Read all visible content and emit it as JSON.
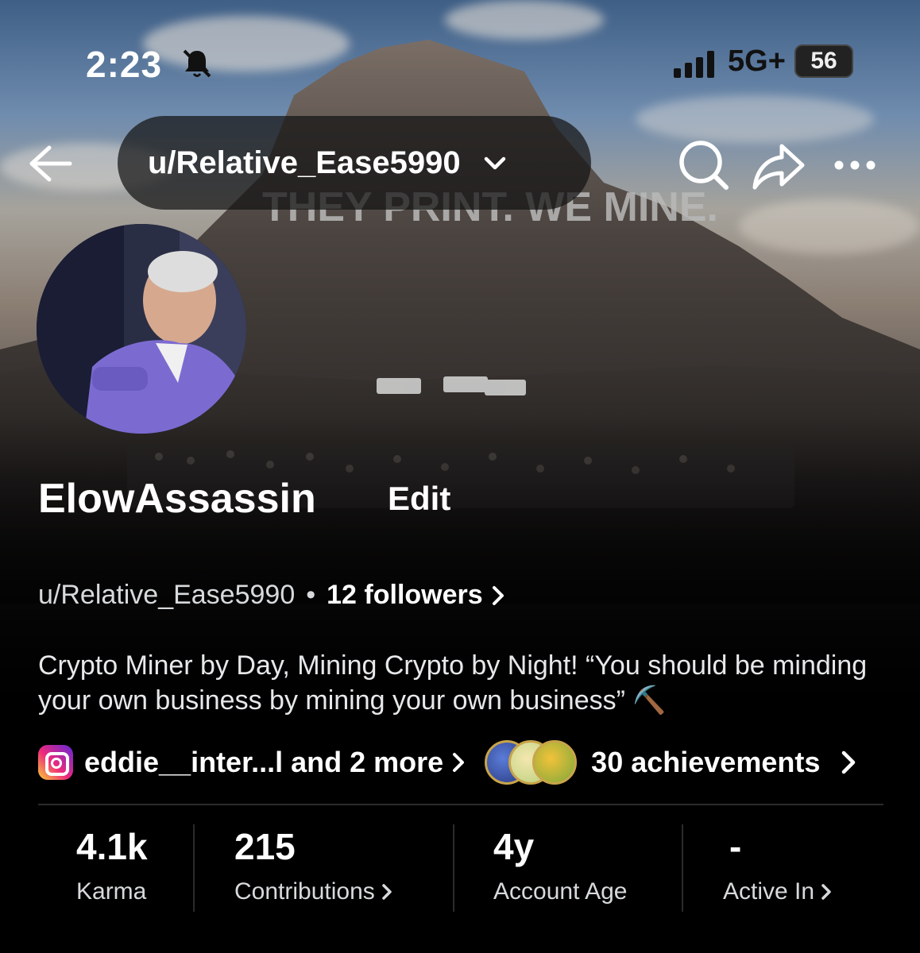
{
  "status_bar": {
    "time": "2:23",
    "network": "5G+",
    "battery": "56",
    "icons": [
      "bell-slash-icon",
      "signal-icon"
    ]
  },
  "nav": {
    "username": "u/Relative_Ease5990",
    "icons": [
      "back-arrow-icon",
      "chevron-down-icon",
      "search-icon",
      "share-icon",
      "more-icon"
    ]
  },
  "banner": {
    "sign_text": "THEY PRINT. WE MINE."
  },
  "profile": {
    "display_name": "ElowAssassin",
    "edit_label": "Edit",
    "username": "u/Relative_Ease5990",
    "separator": "•",
    "followers": "12 followers",
    "bio": "Crypto Miner by Day, Mining Crypto by Night! “You should be minding your own business by mining your own business” ⛏️",
    "social_links": "eddie__inter...l and 2 more",
    "achievements": "30 achievements"
  },
  "stats": [
    {
      "value": "4.1k",
      "label": "Karma"
    },
    {
      "value": "215",
      "label": "Contributions"
    },
    {
      "value": "4y",
      "label": "Account Age"
    },
    {
      "value": "-",
      "label": "Active In"
    }
  ],
  "colors": {
    "background": "#000000",
    "pill": "#141414",
    "muted_text": "#d7dadc",
    "divider": "#2b2b2b"
  }
}
